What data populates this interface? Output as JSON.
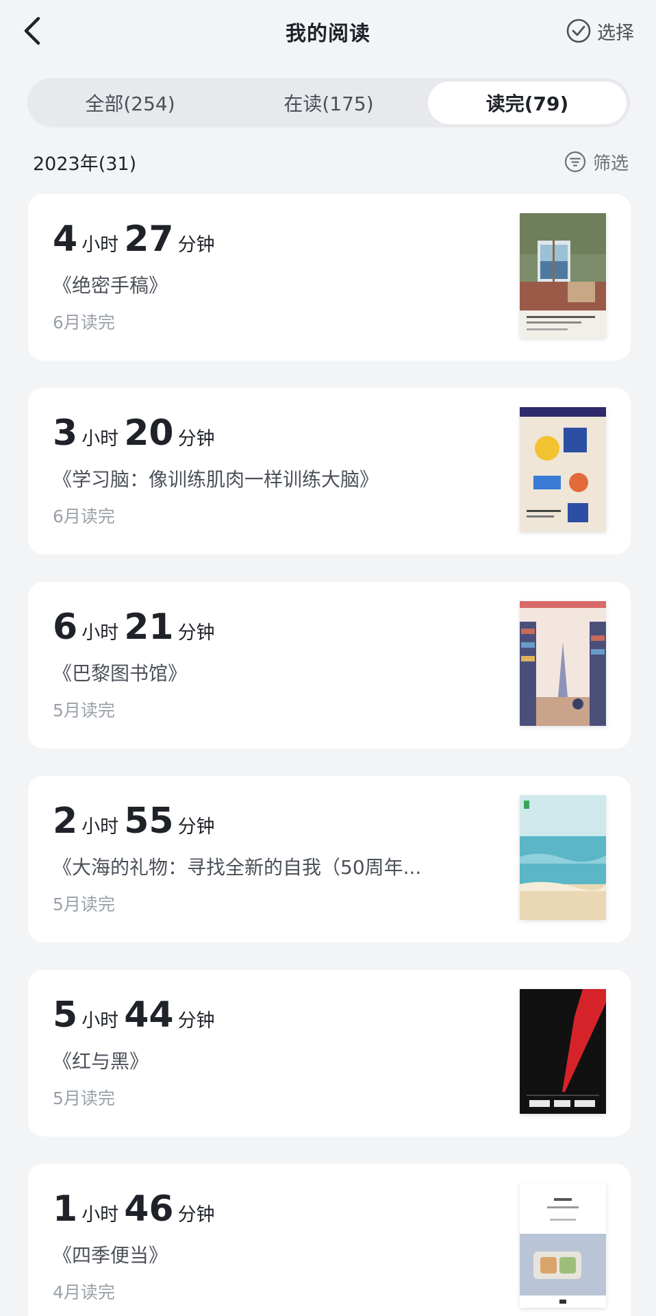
{
  "header": {
    "title": "我的阅读",
    "select_label": "选择"
  },
  "tabs": [
    {
      "label": "全部(254)",
      "active": false
    },
    {
      "label": "在读(175)",
      "active": false
    },
    {
      "label": "读完(79)",
      "active": true
    }
  ],
  "section": {
    "year_label": "2023年(31)",
    "filter_label": "筛选"
  },
  "books": [
    {
      "hours": "4",
      "minutes": "27",
      "title": "《绝密手稿》",
      "finished": "6月读完",
      "cover": "window-painting"
    },
    {
      "hours": "3",
      "minutes": "20",
      "title": "《学习脑：像训练肌肉一样训练大脑》",
      "finished": "6月读完",
      "cover": "learning-brain"
    },
    {
      "hours": "6",
      "minutes": "21",
      "title": "《巴黎图书馆》",
      "finished": "5月读完",
      "cover": "paris-library"
    },
    {
      "hours": "2",
      "minutes": "55",
      "title": "《大海的礼物：寻找全新的自我（50周年...",
      "finished": "5月读完",
      "cover": "sea"
    },
    {
      "hours": "5",
      "minutes": "44",
      "title": "《红与黑》",
      "finished": "5月读完",
      "cover": "red-black"
    },
    {
      "hours": "1",
      "minutes": "46",
      "title": "《四季便当》",
      "finished": "4月读完",
      "cover": "bento"
    }
  ],
  "units": {
    "hour": "小时",
    "minute": "分钟"
  },
  "colors": {
    "background": "#f3f4f6",
    "card": "#ffffff",
    "tab_track": "#e7e9ec",
    "text_primary": "#1f2329",
    "text_muted": "#9aa0a8"
  }
}
